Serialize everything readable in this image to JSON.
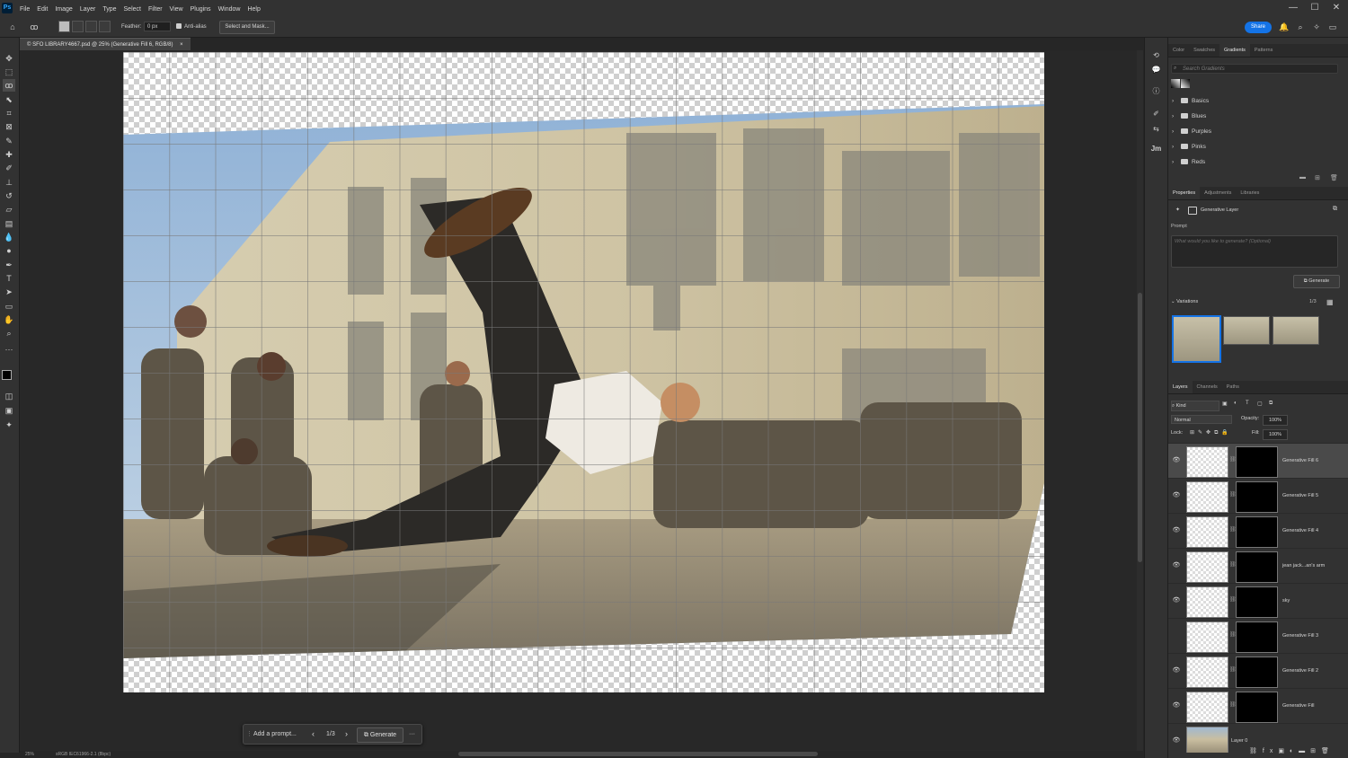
{
  "app": {
    "logo": "Ps",
    "menus": [
      "File",
      "Edit",
      "Image",
      "Layer",
      "Type",
      "Select",
      "Filter",
      "View",
      "Plugins",
      "Window",
      "Help"
    ],
    "window_controls": {
      "minimize": "—",
      "maximize": "☐",
      "close": "✕"
    }
  },
  "options_bar": {
    "feather_label": "Feather:",
    "feather_value": "0 px",
    "antialias_label": "Anti-alias",
    "select_mask_label": "Select and Mask...",
    "share_label": "Share"
  },
  "document": {
    "tab_title": "© SFO LIBRARY4667.psd @ 25% (Generative Fill 6, RGB/8)",
    "tab_close": "×"
  },
  "status_bar": {
    "zoom": "25%",
    "profile": "sRGB IEC61966-2.1 (8bpc)"
  },
  "generative_bar": {
    "prompt_placeholder": "Add a prompt...",
    "counter": "1/3",
    "generate_label": "Generate",
    "more": "···"
  },
  "panels": {
    "top_tabs": [
      "Color",
      "Swatches",
      "Gradients",
      "Patterns"
    ],
    "top_active": "Gradients",
    "gradient_search_placeholder": "Search Gradients",
    "gradient_folders": [
      "Basics",
      "Blues",
      "Purples",
      "Pinks",
      "Reds"
    ],
    "props_tabs": [
      "Properties",
      "Adjustments",
      "Libraries"
    ],
    "props_active": "Properties",
    "layer_type": "Generative Layer",
    "prompt_label": "Prompt",
    "prompt_placeholder": "What would you like to generate? (Optional)",
    "generate_label": "Generate",
    "variations_label": "Variations",
    "variations_count": "1/3",
    "layers_tabs": [
      "Layers",
      "Channels",
      "Paths"
    ],
    "layers_active": "Layers",
    "filter_kind": "Kind",
    "blend_mode": "Normal",
    "opacity_label": "Opacity:",
    "opacity_value": "100%",
    "lock_label": "Lock:",
    "fill_label": "Fill:",
    "fill_value": "100%",
    "layers": [
      {
        "name": "Generative Fill 6",
        "visible": true,
        "selected": true
      },
      {
        "name": "Generative Fill 5",
        "visible": true,
        "selected": false
      },
      {
        "name": "Generative Fill 4",
        "visible": true,
        "selected": false
      },
      {
        "name": "jean jack...an's arm",
        "visible": true,
        "selected": false
      },
      {
        "name": "sky",
        "visible": true,
        "selected": false
      },
      {
        "name": "Generative Fill 3",
        "visible": false,
        "selected": false
      },
      {
        "name": "Generative Fill 2",
        "visible": true,
        "selected": false
      },
      {
        "name": "Generative Fill",
        "visible": true,
        "selected": false
      },
      {
        "name": "Layer 0",
        "visible": true,
        "selected": false
      }
    ]
  },
  "colors": {
    "accent": "#1473e6",
    "panel_bg": "#323232",
    "canvas_bg": "#282828"
  }
}
